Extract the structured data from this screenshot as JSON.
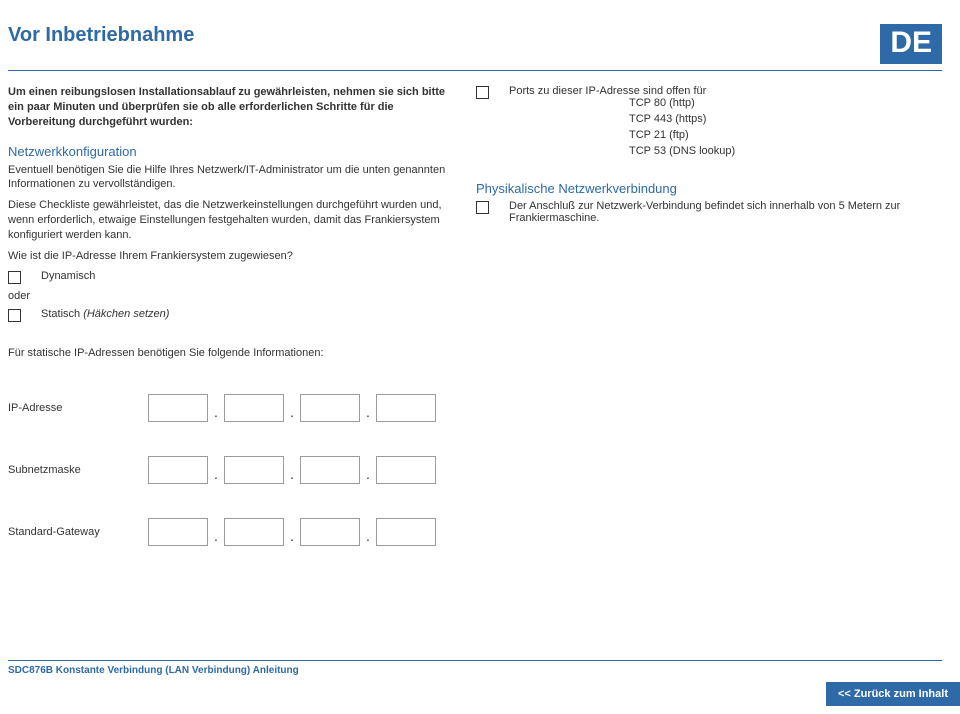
{
  "header": {
    "title": "Vor Inbetriebnahme",
    "lang_badge": "DE"
  },
  "left": {
    "intro": "Um einen reibungslosen Installationsablauf zu gewährleisten, nehmen sie sich bitte ein paar Minuten und überprüfen sie ob alle erforderlichen Schritte für die Vorbereitung durchgeführt wurden:",
    "netconfig_heading": "Netzwerkkonfiguration",
    "netconfig_p1": "Eventuell benötigen Sie die Hilfe Ihres Netzwerk/IT-Administrator um die unten genannten Informationen zu vervollständigen.",
    "netconfig_p2": "Diese Checkliste gewährleistet, das die Netzwerkeinstellungen durchgeführt wurden und, wenn erforderlich, etwaige Einstellungen festgehalten wurden, damit das Frankiersystem konfiguriert werden kann.",
    "ip_question": "Wie ist die IP-Adresse Ihrem Frankiersystem zugewiesen?",
    "dynamic": "Dynamisch",
    "oder": "oder",
    "static": "Statisch ",
    "static_note": "(Häkchen setzen)",
    "static_info": "Für statische IP-Adressen benötigen Sie folgende Informationen:",
    "labels": {
      "ip": "IP-Adresse",
      "subnet": "Subnetzmaske",
      "gateway": "Standard-Gateway"
    }
  },
  "right": {
    "ports_intro": "Ports zu dieser IP-Adresse sind offen für",
    "ports": [
      "TCP 80 (http)",
      "TCP 443 (https)",
      "TCP 21 (ftp)",
      "TCP 53 (DNS lookup)"
    ],
    "phys_heading": "Physikalische Netzwerkverbindung",
    "phys_text": "Der Anschluß zur Netzwerk-Verbindung befindet sich innerhalb von 5 Metern zur Frankiermaschine."
  },
  "footer": {
    "doc_id": "SDC876B Konstante Verbindung (LAN Verbindung) Anleitung",
    "back": "<< Zurück zum Inhalt"
  }
}
